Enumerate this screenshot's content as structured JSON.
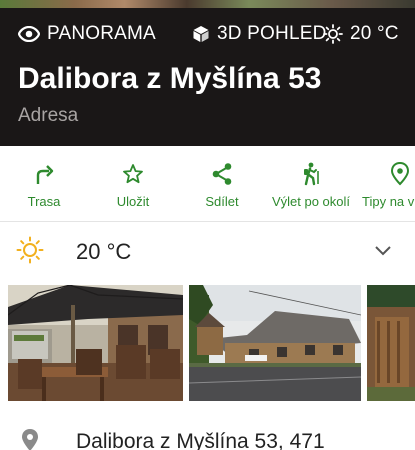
{
  "header": {
    "panorama_label": "PANORAMA",
    "view3d_label": "3D POHLED",
    "weather_label": "20 °C",
    "title": "Dalibora z Myšlína 53",
    "subtitle": "Adresa"
  },
  "actions": [
    {
      "label": "Trasa",
      "icon": "route-icon"
    },
    {
      "label": "Uložit",
      "icon": "star-icon"
    },
    {
      "label": "Sdílet",
      "icon": "share-icon"
    },
    {
      "label": "Výlet po okolí",
      "icon": "hiker-icon"
    },
    {
      "label": "Tipy na v",
      "icon": "location-pin-icon"
    }
  ],
  "weather": {
    "temperature": "20 °C",
    "icon": "sun-icon",
    "expand_icon": "chevron-down-icon"
  },
  "gallery": {
    "photos": [
      "terrace-umbrella-photo",
      "cottage-street-photo",
      "gate-photo"
    ]
  },
  "address": {
    "icon": "location-pin-icon",
    "text": "Dalibora z Myšlína 53, 471"
  },
  "colors": {
    "header_bg": "#1a1717",
    "accent_green": "#2e8a2e",
    "weather_sun": "#f2b01e"
  }
}
